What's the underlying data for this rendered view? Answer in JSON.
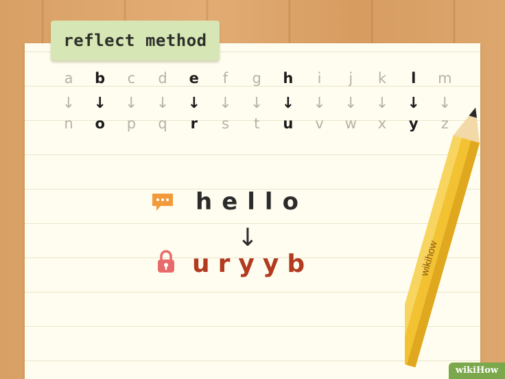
{
  "tag": {
    "label": "reflect method"
  },
  "alphabet": [
    {
      "top": "a",
      "bottom": "n",
      "highlight": false
    },
    {
      "top": "b",
      "bottom": "o",
      "highlight": true
    },
    {
      "top": "c",
      "bottom": "p",
      "highlight": false
    },
    {
      "top": "d",
      "bottom": "q",
      "highlight": false
    },
    {
      "top": "e",
      "bottom": "r",
      "highlight": true
    },
    {
      "top": "f",
      "bottom": "s",
      "highlight": false
    },
    {
      "top": "g",
      "bottom": "t",
      "highlight": false
    },
    {
      "top": "h",
      "bottom": "u",
      "highlight": true
    },
    {
      "top": "i",
      "bottom": "v",
      "highlight": false
    },
    {
      "top": "j",
      "bottom": "w",
      "highlight": false
    },
    {
      "top": "k",
      "bottom": "x",
      "highlight": false
    },
    {
      "top": "l",
      "bottom": "y",
      "highlight": true
    },
    {
      "top": "m",
      "bottom": "z",
      "highlight": false
    }
  ],
  "arrow_glyph": "↓",
  "plaintext": "hello",
  "ciphertext": "uryyb",
  "pencil_text": "wikihow",
  "watermark": "wikiHow",
  "icons": {
    "message": "speech-bubble-icon",
    "lock": "lock-icon"
  },
  "colors": {
    "paper": "#fffdef",
    "tag": "#d6e6b4",
    "cipher": "#b23a1f",
    "message_icon": "#f29a3a",
    "lock_icon": "#e86b6b",
    "pencil": "#f2c233"
  }
}
